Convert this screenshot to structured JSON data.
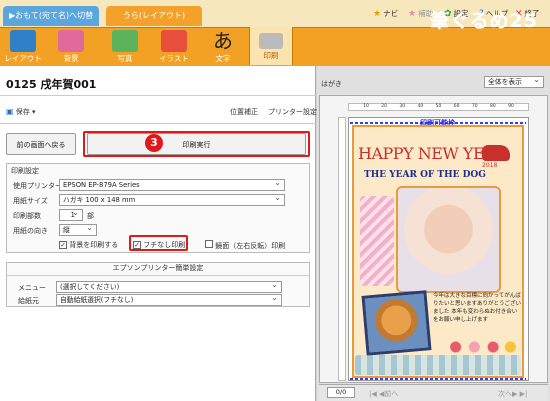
{
  "tabs": {
    "front": "▶おもて(宛て名)へ切替",
    "back": "うら(レイアウト)"
  },
  "top_menu": [
    {
      "label": "ナビ",
      "icon": "star-icon"
    },
    {
      "label": "補助",
      "icon": "star-gray-icon"
    },
    {
      "label": "設定",
      "icon": "gear-icon"
    },
    {
      "label": "ヘルプ",
      "icon": "help-icon"
    },
    {
      "label": "終了",
      "icon": "close-icon"
    }
  ],
  "toolbar": {
    "items": [
      "レイアウト",
      "背景",
      "写真",
      "イラスト",
      "文字",
      "印刷"
    ],
    "selected": "印刷",
    "brand": "筆ぐるめ25"
  },
  "doc": {
    "title": "0125 戌年賀001"
  },
  "actions": {
    "save": "保存",
    "position": "位置補正",
    "printer_settings": "プリンター設定"
  },
  "buttons": {
    "back": "前の画面へ戻る",
    "print": "印刷実行"
  },
  "step_badge": "3",
  "print_settings": {
    "section": "印刷設定",
    "printer_label": "使用プリンター",
    "printer_value": "EPSON EP-879A Series",
    "paper_label": "用紙サイズ",
    "paper_value": "ハガキ 100 x 148 mm",
    "copies_label": "印刷部数",
    "copies_value": "1",
    "copies_unit": "部",
    "orientation_label": "用紙の向き",
    "orientation_value": "縦",
    "bg_print": "背景を印刷する",
    "borderless": "フチなし印刷",
    "mirror": "鏡面（左右反転）印刷"
  },
  "epson": {
    "section": "エプソンプリンター簡単設定",
    "menu_label": "メニュー",
    "menu_value": "(選択してください)",
    "feed_label": "給紙元",
    "feed_value": "自動給紙選択(フチなし)"
  },
  "preview": {
    "paper_label": "はがき",
    "zoom": "全体を表示",
    "printable_label": "印刷可能枠",
    "page": "0/0",
    "prev": "前へ",
    "next": "次へ",
    "ruler_ticks": [
      "10",
      "20",
      "30",
      "40",
      "50",
      "60",
      "70",
      "80",
      "90"
    ]
  },
  "card": {
    "title": "HAPPY NEW YEAR",
    "year": "2018",
    "subtitle": "THE YEAR OF THE DOG",
    "message": "今年は大きな目標に向かってがんばりたいと思いますありがとうございました 本年も変わらぬお付き合いをお願い申し上げます"
  },
  "colors": {
    "orange": "#f3a124",
    "red": "#e21818",
    "card_red": "#c8302e",
    "title_blue": "#1d2f8a"
  }
}
